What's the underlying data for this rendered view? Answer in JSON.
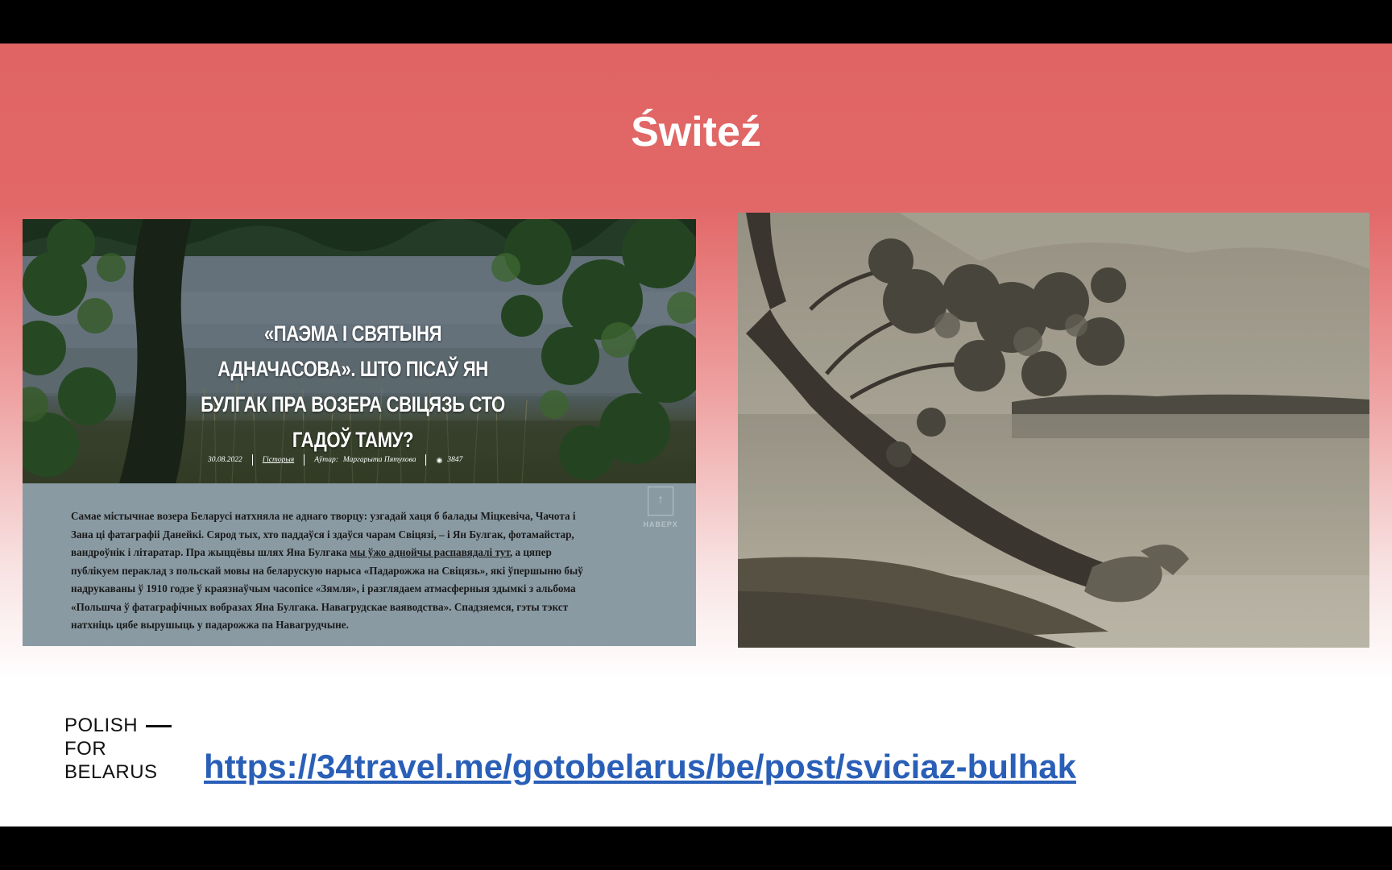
{
  "slide": {
    "title": "Świteź"
  },
  "article_screenshot": {
    "heading": "«ПАЭМА І СВЯТЫНЯ АДНАЧАСОВА». ШТО ПІСАЎ ЯН БУЛГАК ПРА ВОЗЕРА СВІЦЯЗЬ СТО ГАДОЎ ТАМУ?",
    "meta": {
      "date": "30.08.2022",
      "category": "Гісторыя",
      "author_label": "Аўтар:",
      "author": "Маргарыта Пятухова",
      "views": "3847"
    },
    "up_button_label": "НАВЕРХ",
    "body_before_link": "Самае містычнае возера Беларусі натхняла не аднаго творцу: узгадай хаця б балады Міцкевіча, Чачота і Зана ці фатаграфіі Данейкі. Сярод тых, хто паддаўся і здаўся чарам Свіцязі, – і Ян Булгак, фотамайстар, вандроўнік і літаратар. Пра жыццёвы шлях Яна Булгака ",
    "body_link": "мы ўжо аднойчы распавядалі тут",
    "body_after_link": ", а цяпер публікуем пераклад з польскай мовы на беларускую нарыса «Падарожжа на Свіцязь», які ўпершыню быў надрукаваны ў 1910 годзе ў краязнаўчым часопісе «Зямля», і разглядаем атмасферныя здымкі з альбома «Польшча ў фатаграфічных вобразах Яна Булгака. Навагрудскае ваяводства». Спадзяемся, гэты тэкст натхніць цябе вырушыць у падарожжа па Навагрудчыне."
  },
  "footer": {
    "logo_lines": [
      "POLISH",
      "FOR",
      "BELARUS"
    ],
    "link": "https://34travel.me/gotobelarus/be/post/sviciaz-bulhak"
  },
  "icons": {
    "eye": "eye-icon",
    "arrow_up": "arrow-up-icon"
  },
  "colors": {
    "header_red": "#e06464",
    "link_blue": "#2a5fb8",
    "article_panel": "#8a9aa3"
  }
}
